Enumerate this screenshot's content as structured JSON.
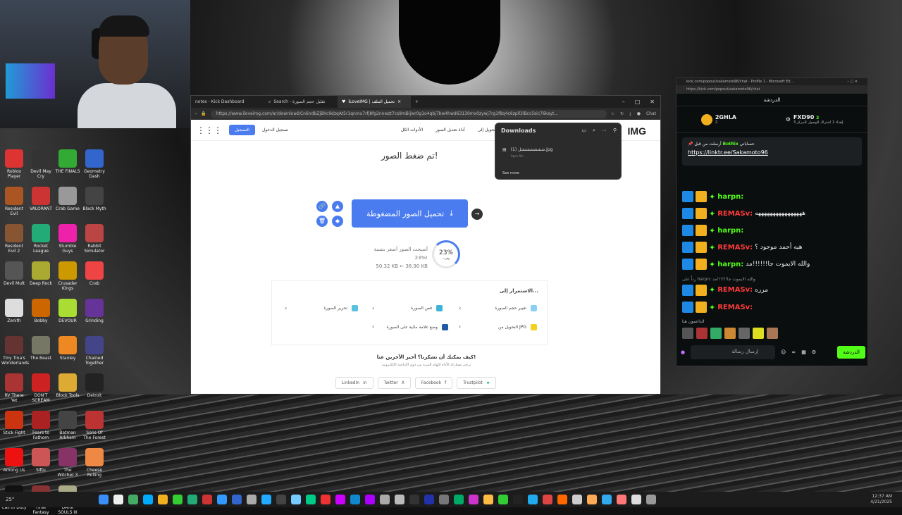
{
  "browser": {
    "tabs": [
      "notes - Kick Dashboard",
      "Search - تقليل حجم الصورة",
      "iLoveIMG | تحميل الملف"
    ],
    "url": "https://www.iloveimg.com/ar/download/Cn6ndbZjBhc9dzqAt5r1qnmx7rfj8fg2nnwzt7cs9mBijwr0g1o4qbj7bw4hwd63130mx0zywj7rg1f8q4c6zpll3lBcc5sic76ksyt...",
    "chat_label": "Chat"
  },
  "page": {
    "logo": "IMG",
    "register": "التسجيل",
    "login": "تسجيل الدخول",
    "nav": [
      "الأدوات الكل",
      "أداة تعديل الصور",
      "التحويل إلى JPG",
      "الصورة"
    ],
    "heading": "تم ضغط الصور!",
    "download_button": "تحميل الصور المضغوطة",
    "stat_line1": "أصبحت الصور أصغر بنسبة 23%!",
    "stat_line2": "50.32 KB ← 38.90 KB",
    "percent": "23%",
    "percent_sub": "وفرت",
    "continue_title": "الاستمرار إلى...",
    "continue_items": [
      "تغيير حجم الصورة",
      "قص الصورة",
      "تحرير الصورة",
      "التحويل من JPG",
      "وضع علامة مائية على الصورة"
    ],
    "share_title": "كيف يمكنك أن تشكرنا؟ أخبر الآخرين عنا!",
    "share_sub": "يرجى مشاركة الأداة لإلهام المزيد من ذوي الإنتاجية الإلكترونية",
    "share_buttons": [
      "LinkedIn",
      "Twitter",
      "Facebook",
      "Trustpilot"
    ]
  },
  "downloads": {
    "title": "Downloads",
    "file_name": "شششششتشل (1).jpg",
    "file_action": "Open file",
    "see_more": "See more"
  },
  "kick": {
    "window_title": "kick.com/popout/sakamoto96/chat - Profile 1 - Microsoft Ed...",
    "address": "https://kick.com/popout/sakamoto96/chat",
    "header": "الدردشة",
    "gift1_user": "2GHLA",
    "gift1_count": "2",
    "gift2_user": "FXD90",
    "gift2_sub": "إهداء 1 اشتراك للوصول للمركز 3",
    "gift2_count": "2",
    "pin_label": "أرسلت من قبل",
    "pin_user": "BotRix",
    "pin_text": "حساباتي",
    "pin_link": "https://linktr.ee/Sakamoto96",
    "messages": [
      {
        "user": "harpn:",
        "text": "",
        "color": "g"
      },
      {
        "user": "REMASv:",
        "text": "ههههههههههههههههه",
        "color": "r"
      },
      {
        "user": "harpn:",
        "text": "",
        "color": "g"
      },
      {
        "user": "REMASv:",
        "text": "هيه أحمد موجود ؟",
        "color": "r"
      },
      {
        "user": "harpn:",
        "text": "والله الايموت جا!!!!!!مد",
        "color": "g"
      },
      {
        "user": "REMASv:",
        "text": "مرره",
        "color": "r"
      },
      {
        "user": "REMASv:",
        "text": "",
        "color": "r"
      }
    ],
    "reply_note": "رداً على harpn: والله الايموت جا!!!!!!مد",
    "supporters": "الداعمون هنا",
    "input_placeholder": "إرسال رسالة",
    "send_label": "الدردشة"
  },
  "taskbar": {
    "weather": "25°",
    "time": "12:37 AM",
    "date": "4/21/2025"
  },
  "desktop_icons": [
    "Roblox Player",
    "Devil May Cry",
    "THE FINALS",
    "Geometry Dash",
    "Resident Evil",
    "VALORANT",
    "Crab Game",
    "Black Myth",
    "Resident Evil 2",
    "Rocket League",
    "Stumble Guys",
    "Rabbit Simulator",
    "Devil Mult",
    "Deep Rock",
    "Crusader Kings",
    "Crab",
    "Zenith",
    "Bobby",
    "DEVOUR",
    "Grinding",
    "Tiny Tina's Wonderlands",
    "The Beast",
    "Stanley",
    "Chained Together",
    "RV There Yet",
    "DON'T SCREAM",
    "Block Tools",
    "Detroit",
    "Stick Fight",
    "Fears to Fathom",
    "Batman Arkham",
    "Sons Of The Forest",
    "Among Us",
    "Siftu",
    "The Witcher 3",
    "Cheese Rolling",
    "Call of Duty",
    "Final Fantasy",
    "DARK SOULS III"
  ]
}
